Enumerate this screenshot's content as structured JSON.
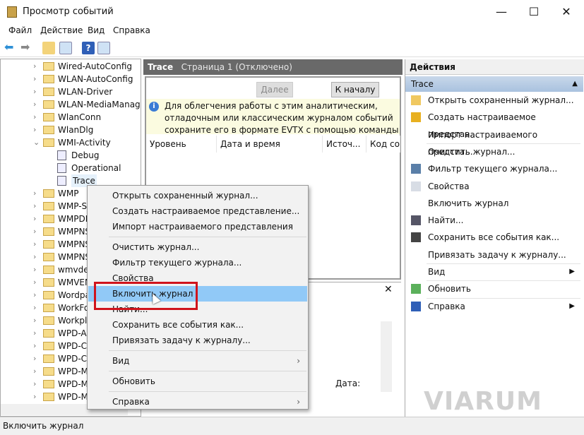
{
  "window": {
    "title": "Просмотр событий",
    "minimize": "—",
    "maximize": "☐",
    "close": "✕"
  },
  "menubar": [
    "Файл",
    "Действие",
    "Вид",
    "Справка"
  ],
  "tree": [
    {
      "label": "Wired-AutoConfig",
      "type": "folder",
      "chev": "›"
    },
    {
      "label": "WLAN-AutoConfig",
      "type": "folder",
      "chev": "›"
    },
    {
      "label": "WLAN-Driver",
      "type": "folder",
      "chev": "›"
    },
    {
      "label": "WLAN-MediaManager",
      "type": "folder",
      "chev": "›"
    },
    {
      "label": "WlanConn",
      "type": "folder",
      "chev": "›"
    },
    {
      "label": "WlanDlg",
      "type": "folder",
      "chev": "›"
    },
    {
      "label": "WMI-Activity",
      "type": "folder",
      "chev": "⌄"
    },
    {
      "label": "Debug",
      "type": "log",
      "chev": ""
    },
    {
      "label": "Operational",
      "type": "log",
      "chev": ""
    },
    {
      "label": "Trace",
      "type": "log",
      "chev": "",
      "selected": true
    },
    {
      "label": "WMP",
      "type": "folder",
      "chev": "›"
    },
    {
      "label": "WMP-Sc",
      "type": "folder",
      "chev": "›"
    },
    {
      "label": "WMPDM",
      "type": "folder",
      "chev": "›"
    },
    {
      "label": "WMPNS",
      "type": "folder",
      "chev": "›"
    },
    {
      "label": "WMPNS",
      "type": "folder",
      "chev": "›"
    },
    {
      "label": "WMPNS",
      "type": "folder",
      "chev": "›"
    },
    {
      "label": "wmvdec",
      "type": "folder",
      "chev": "›"
    },
    {
      "label": "WMVEN",
      "type": "folder",
      "chev": "›"
    },
    {
      "label": "Wordpa",
      "type": "folder",
      "chev": "›"
    },
    {
      "label": "WorkFo",
      "type": "folder",
      "chev": "›"
    },
    {
      "label": "Workpla",
      "type": "folder",
      "chev": "›"
    },
    {
      "label": "WPD-AP",
      "type": "folder",
      "chev": "›"
    },
    {
      "label": "WPD-Cl",
      "type": "folder",
      "chev": "›"
    },
    {
      "label": "WPD-Co",
      "type": "folder",
      "chev": "›"
    },
    {
      "label": "WPD-M",
      "type": "folder",
      "chev": "›"
    },
    {
      "label": "WPD-M",
      "type": "folder",
      "chev": "›"
    },
    {
      "label": "WPD-M",
      "type": "folder",
      "chev": "›"
    }
  ],
  "center": {
    "log_name": "Trace",
    "page": "Страница 1",
    "status": "(Отключено)",
    "next_button": "Далее",
    "first_button": "К началу",
    "info": "Для облегчения работы с этим аналитическим, отладочным или классическим журналом событий сохраните его в формате EVTX с помощью команды",
    "columns": [
      "Уровень",
      "Дата и время",
      "Источ...",
      "Код со..."
    ],
    "lower_close": "✕",
    "date_label": "Дата:"
  },
  "actions": {
    "header": "Действия",
    "section": "Trace",
    "items": [
      {
        "label": "Открыть сохраненный журнал...",
        "icon": "folder-open-icon"
      },
      {
        "label": "Создать настраиваемое представ...",
        "icon": "filter-create-icon"
      },
      {
        "label": "Импорт настраиваемого предста...",
        "icon": ""
      },
      {
        "label": "Очистить журнал...",
        "icon": ""
      },
      {
        "label": "Фильтр текущего журнала...",
        "icon": "filter-icon"
      },
      {
        "label": "Свойства",
        "icon": "properties-icon"
      },
      {
        "label": "Включить журнал",
        "icon": ""
      },
      {
        "label": "Найти...",
        "icon": "binoculars-icon"
      },
      {
        "label": "Сохранить все события как...",
        "icon": "save-icon"
      },
      {
        "label": "Привязать задачу к журналу...",
        "icon": ""
      },
      {
        "label": "Вид",
        "icon": "",
        "submenu": true
      },
      {
        "label": "Обновить",
        "icon": "refresh-icon"
      },
      {
        "label": "Справка",
        "icon": "help-icon",
        "submenu": true
      }
    ]
  },
  "context_menu": [
    {
      "label": "Открыть сохраненный журнал..."
    },
    {
      "label": "Создать настраиваемое представление..."
    },
    {
      "label": "Импорт настраиваемого представления"
    },
    {
      "label": "Очистить журнал..."
    },
    {
      "label": "Фильтр текущего журнала..."
    },
    {
      "label": "Свойства"
    },
    {
      "label": "Включить журнал",
      "highlighted": true
    },
    {
      "label": "Найти..."
    },
    {
      "label": "Сохранить все события как..."
    },
    {
      "label": "Привязать задачу к журналу..."
    },
    {
      "label": "Вид",
      "submenu": true
    },
    {
      "label": "Обновить"
    },
    {
      "label": "Справка",
      "submenu": true
    }
  ],
  "statusbar": "Включить журнал",
  "watermark": "VIARUM",
  "colors": {
    "highlight": "#91c9f7",
    "annotation": "#d0141c",
    "header": "#696969"
  }
}
